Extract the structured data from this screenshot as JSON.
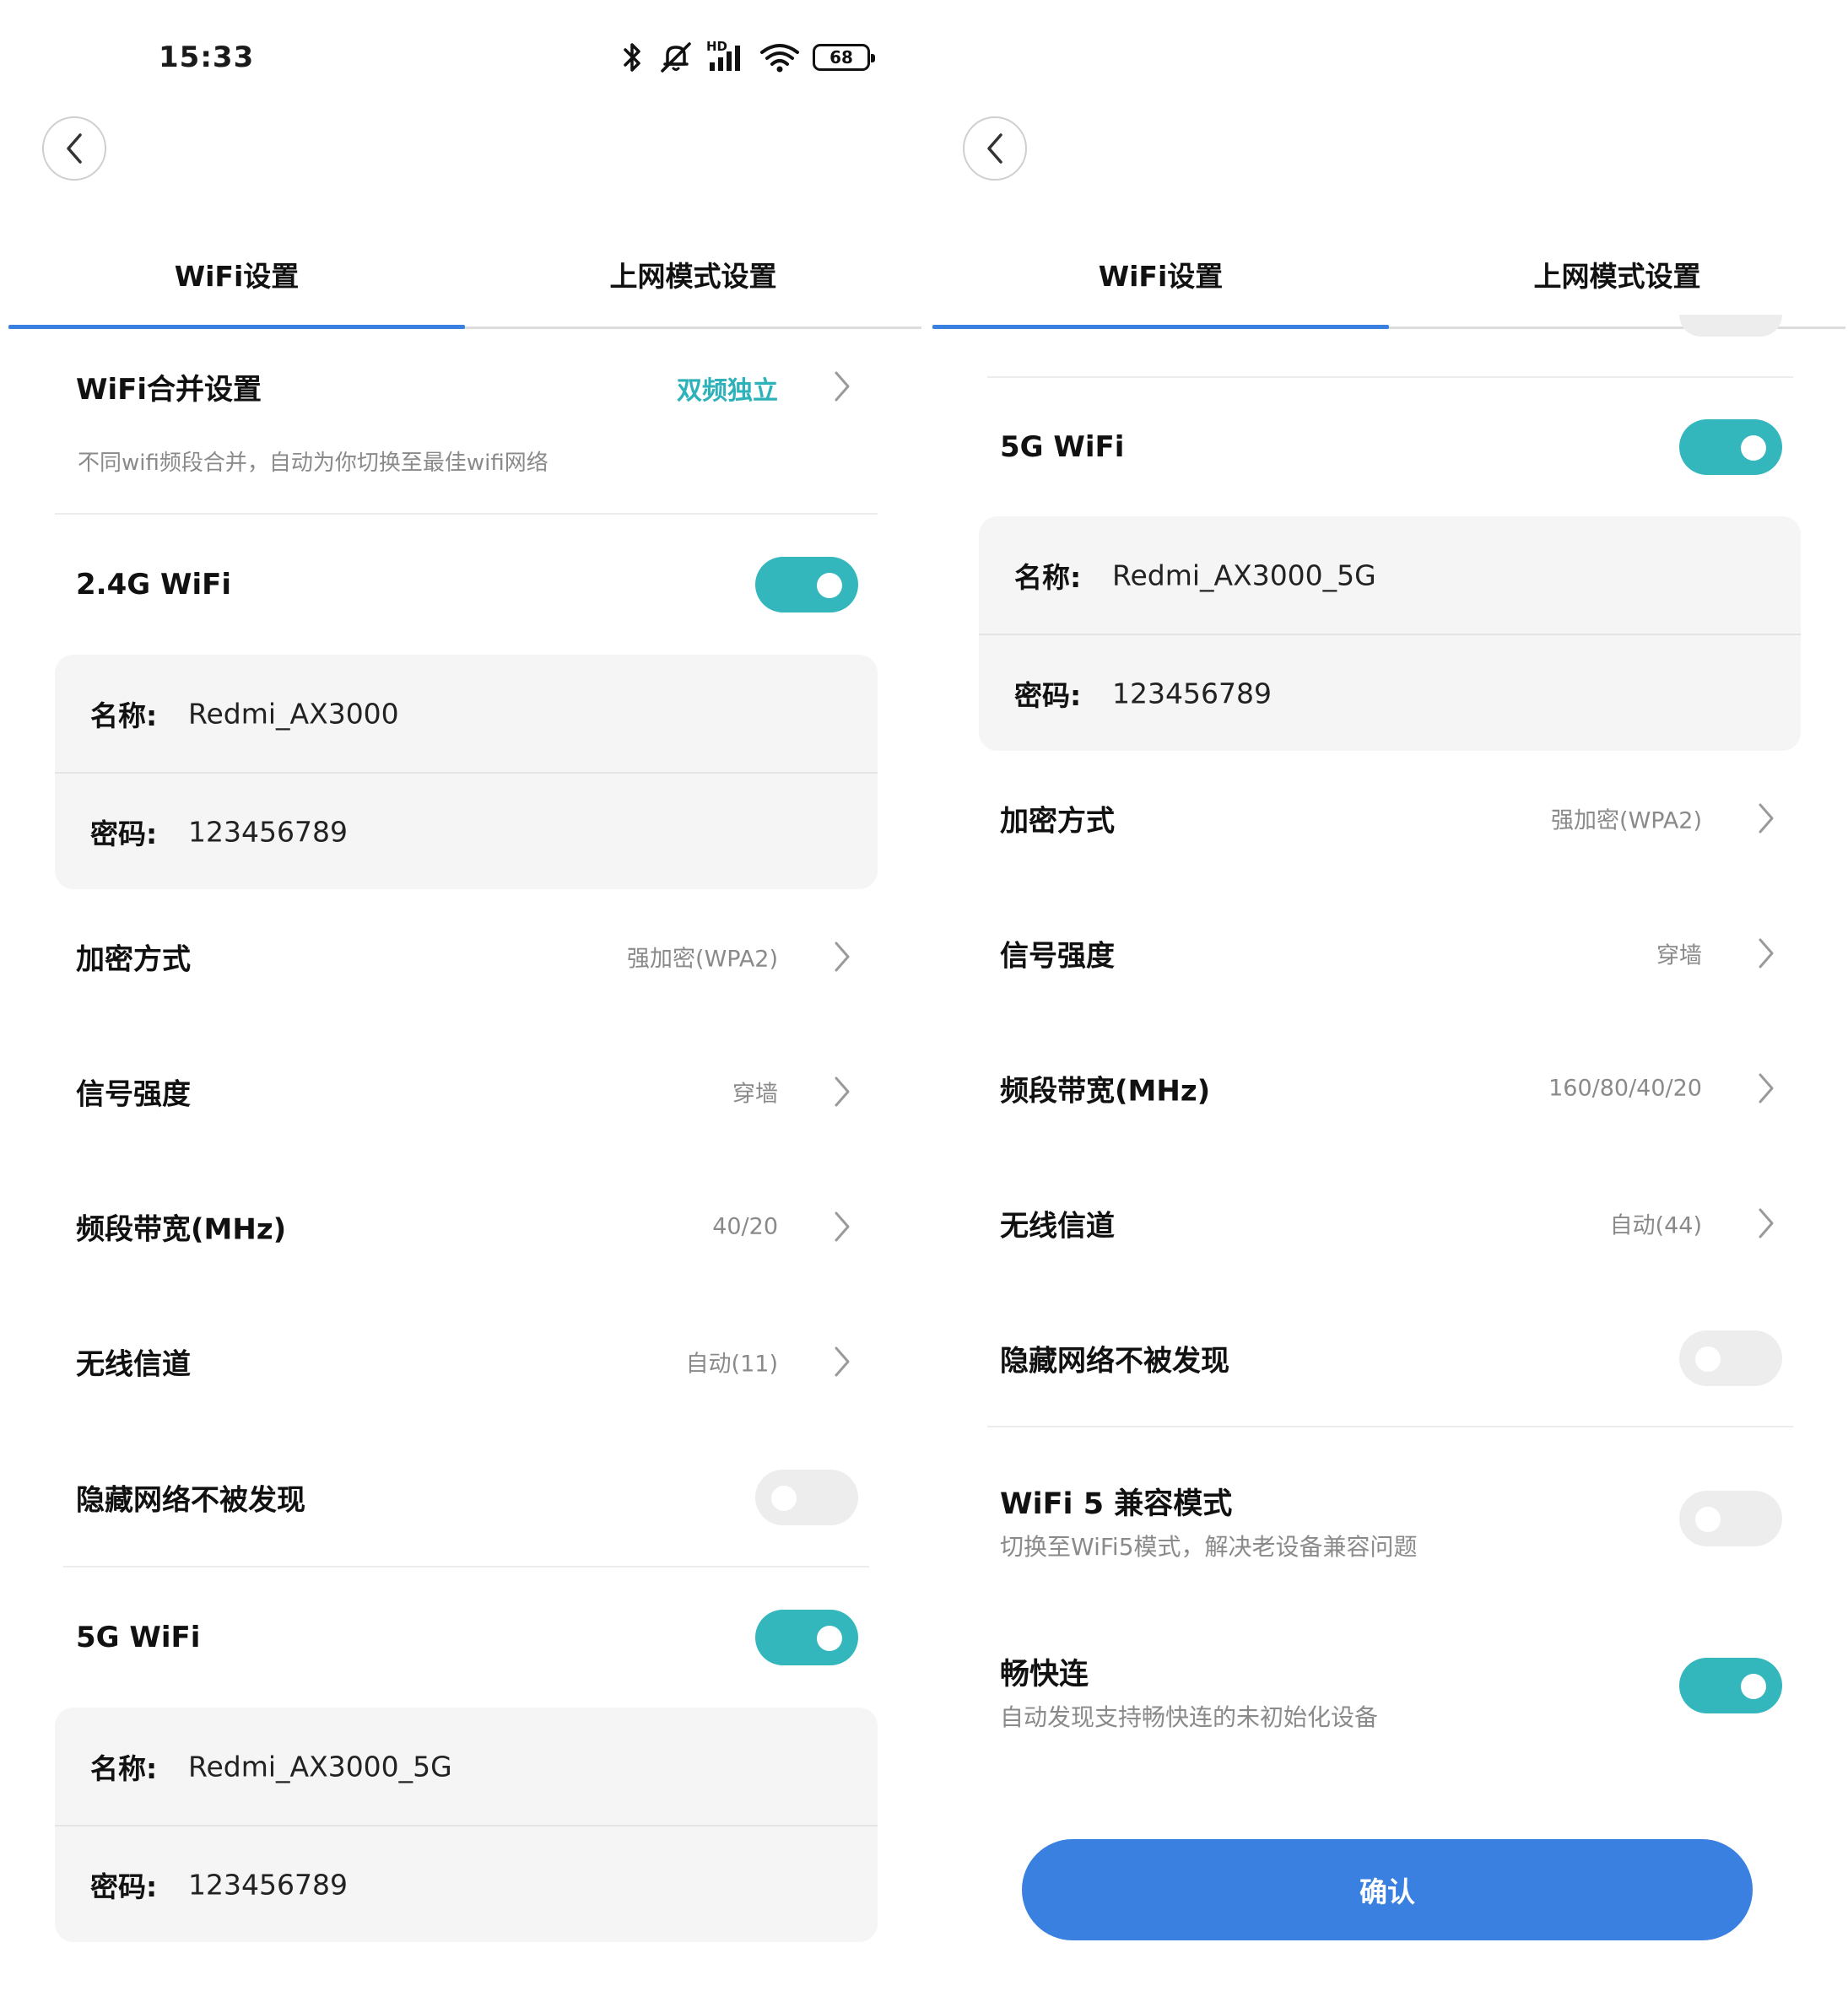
{
  "colors": {
    "accent": "#3a80e0",
    "toggle_on": "#33b7bd",
    "merge_value": "#2eb2ba"
  },
  "left": {
    "status": {
      "time": "15:33",
      "hd_label": "HD",
      "battery": "68"
    },
    "tabs": [
      {
        "label": "WiFi设置",
        "active": true
      },
      {
        "label": "上网模式设置",
        "active": false
      }
    ],
    "merge": {
      "title": "WiFi合并设置",
      "value": "双频独立",
      "subtitle": "不同wifi频段合并，自动为你切换至最佳wifi网络"
    },
    "wifi24": {
      "label": "2.4G WiFi",
      "enabled": true
    },
    "wifi24_cred": {
      "name_key": "名称:",
      "name": "Redmi_AX3000",
      "pwd_key": "密码:",
      "pwd": "123456789"
    },
    "settings": [
      {
        "label": "加密方式",
        "value": "强加密(WPA2)"
      },
      {
        "label": "信号强度",
        "value": "穿墙"
      },
      {
        "label": "频段带宽(MHz)",
        "value": "40/20"
      },
      {
        "label": "无线信道",
        "value": "自动(11)"
      }
    ],
    "hidden": {
      "label": "隐藏网络不被发现",
      "enabled": false
    },
    "wifi5": {
      "label": "5G WiFi",
      "enabled": true
    },
    "wifi5_cred": {
      "name_key": "名称:",
      "name": "Redmi_AX3000_5G",
      "pwd_key": "密码:",
      "pwd": "123456789"
    }
  },
  "right": {
    "tabs": [
      {
        "label": "WiFi设置",
        "active": true
      },
      {
        "label": "上网模式设置",
        "active": false
      }
    ],
    "wifi5": {
      "label": "5G WiFi",
      "enabled": true
    },
    "wifi5_cred": {
      "name_key": "名称:",
      "name": "Redmi_AX3000_5G",
      "pwd_key": "密码:",
      "pwd": "123456789"
    },
    "settings": [
      {
        "label": "加密方式",
        "value": "强加密(WPA2)"
      },
      {
        "label": "信号强度",
        "value": "穿墙"
      },
      {
        "label": "频段带宽(MHz)",
        "value": "160/80/40/20"
      },
      {
        "label": "无线信道",
        "value": "自动(44)"
      }
    ],
    "hidden": {
      "label": "隐藏网络不被发现",
      "enabled": false
    },
    "wifi5_compat": {
      "title": "WiFi 5 兼容模式",
      "desc": "切换至WiFi5模式，解决老设备兼容问题",
      "enabled": false
    },
    "quick_connect": {
      "title": "畅快连",
      "desc": "自动发现支持畅快连的未初始化设备",
      "enabled": true
    },
    "confirm_label": "确认"
  }
}
